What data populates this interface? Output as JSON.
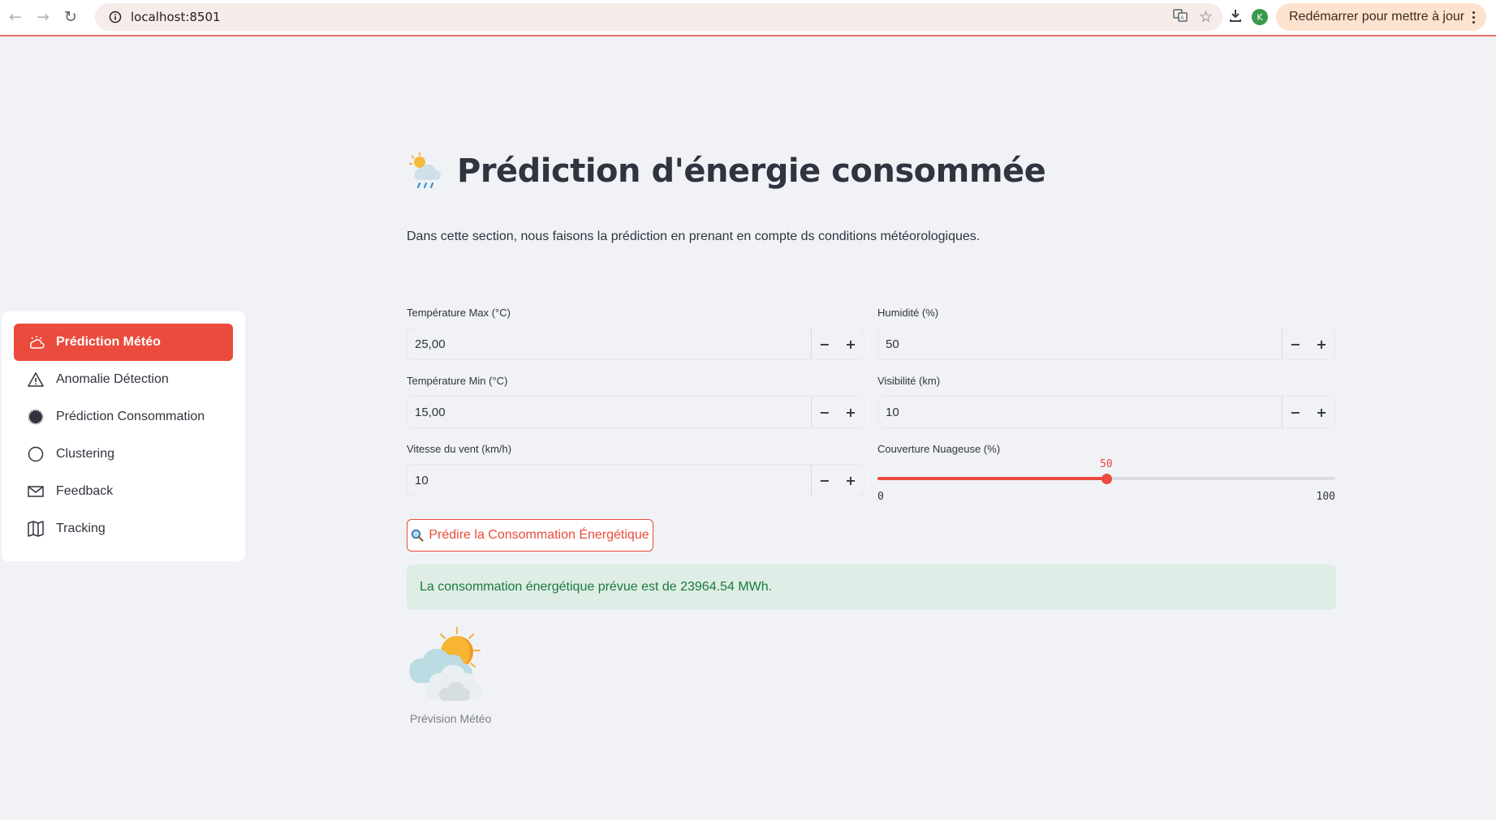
{
  "browser": {
    "url": "localhost:8501",
    "restart_label": "Redémarrer pour mettre à jour",
    "avatar_letter": "K"
  },
  "sidebar": {
    "items": [
      {
        "label": "Prédiction Météo",
        "icon": "weather-icon",
        "active": true
      },
      {
        "label": "Anomalie Détection",
        "icon": "warning-icon",
        "active": false
      },
      {
        "label": "Prédiction Consommation",
        "icon": "moon-icon",
        "active": false
      },
      {
        "label": "Clustering",
        "icon": "circle-icon",
        "active": false
      },
      {
        "label": "Feedback",
        "icon": "envelope-icon",
        "active": false
      },
      {
        "label": "Tracking",
        "icon": "map-icon",
        "active": false
      }
    ]
  },
  "main": {
    "title": "Prédiction d'énergie consommée",
    "intro": "Dans cette section, nous faisons la prédiction en prenant en compte ds conditions météorologiques.",
    "fields": {
      "temp_max": {
        "label": "Température Max (°C)",
        "value": "25,00"
      },
      "humidity": {
        "label": "Humidité (%)",
        "value": "50"
      },
      "temp_min": {
        "label": "Température Min (°C)",
        "value": "15,00"
      },
      "visibility": {
        "label": "Visibilité (km)",
        "value": "10"
      },
      "wind": {
        "label": "Vitesse du vent (km/h)",
        "value": "10"
      }
    },
    "cloud_slider": {
      "label": "Couverture Nuageuse (%)",
      "value": "50",
      "min": "0",
      "max": "100",
      "fraction": 0.5
    },
    "predict_button": "Prédire la Consommation Énergétique",
    "result": "La consommation énergétique prévue est de 23964.54 MWh.",
    "image_caption": "Prévision Météo"
  },
  "colors": {
    "accent": "#ea4b3c",
    "success_bg": "#deede6",
    "success_text": "#1a7a3a",
    "page_bg": "#f0f2f6"
  }
}
